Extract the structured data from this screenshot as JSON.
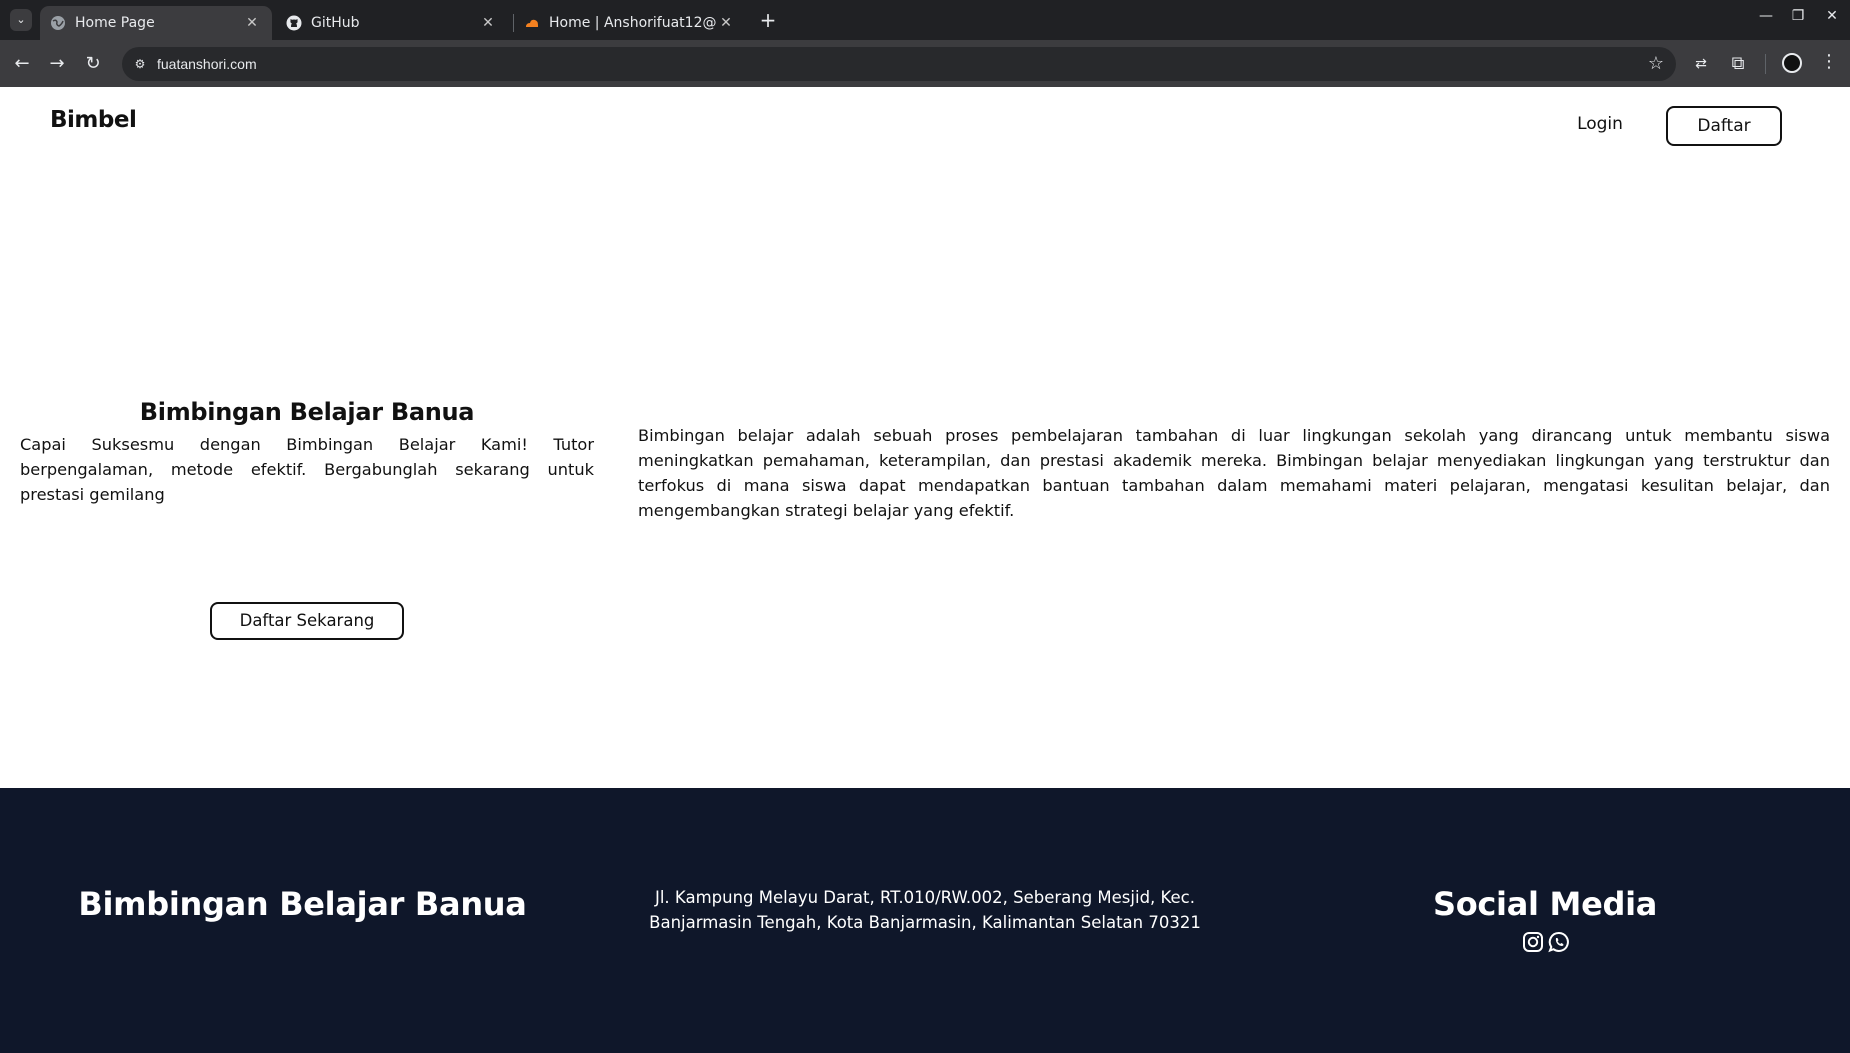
{
  "browser": {
    "tabs": [
      {
        "title": "Home Page",
        "active": true,
        "icon": "globe-icon"
      },
      {
        "title": "GitHub",
        "active": false,
        "icon": "github-icon"
      },
      {
        "title": "Home | Anshorifuat12@",
        "active": false,
        "icon": "cloudflare-icon"
      }
    ],
    "url": "fuatanshori.com"
  },
  "nav": {
    "brand": "Bimbel",
    "login": "Login",
    "register": "Daftar"
  },
  "hero": {
    "title": "Bimbingan Belajar Banua",
    "tagline": "Capai Suksesmu dengan Bimbingan Belajar Kami! Tutor berpengalaman, metode efektif. Bergabunglah sekarang untuk prestasi gemilang",
    "cta": "Daftar Sekarang",
    "description": "Bimbingan belajar adalah sebuah proses pembelajaran tambahan di luar lingkungan sekolah yang dirancang untuk membantu siswa meningkatkan pemahaman, keterampilan, dan prestasi akademik mereka. Bimbingan belajar menyediakan lingkungan yang terstruktur dan terfokus di mana siswa dapat mendapatkan bantuan tambahan dalam memahami materi pelajaran, mengatasi kesulitan belajar, dan mengembangkan strategi belajar yang efektif."
  },
  "footer": {
    "title": "Bimbingan Belajar Banua",
    "address_line1": "Jl. Kampung Melayu Darat, RT.010/RW.002, Seberang Mesjid, Kec.",
    "address_line2": "Banjarmasin Tengah, Kota Banjarmasin, Kalimantan Selatan 70321",
    "social_title": "Social Media",
    "social_icons": [
      "instagram-icon",
      "whatsapp-icon"
    ]
  },
  "colors": {
    "footer_bg": "#0f172a",
    "chrome_dark": "#202124",
    "chrome_toolbar": "#3c3c3f"
  }
}
